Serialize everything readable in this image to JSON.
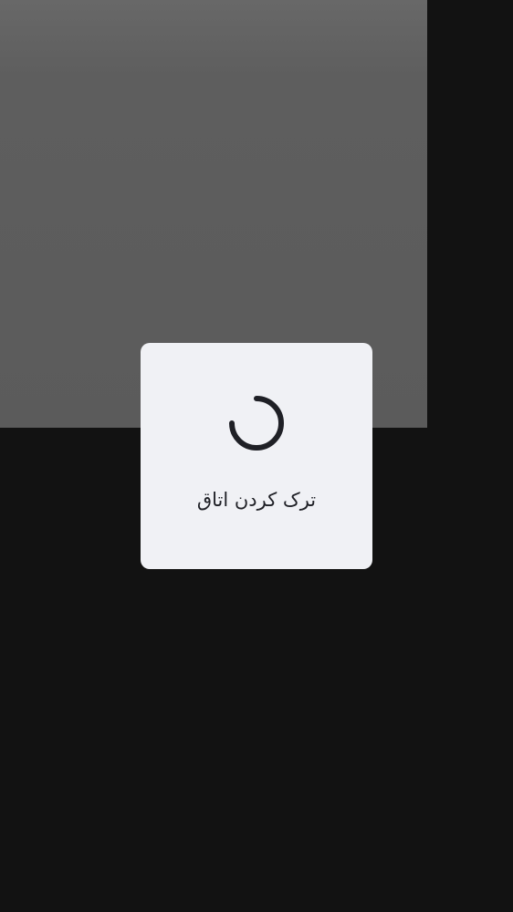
{
  "dialog": {
    "spinner_icon": "loading-spinner-icon",
    "label": "ترک کردن اتاق"
  },
  "colors": {
    "page_background": "#121212",
    "overlay_panel": "#5b5b5b",
    "dialog_background": "#f0f1f5",
    "text": "#1f2026"
  }
}
